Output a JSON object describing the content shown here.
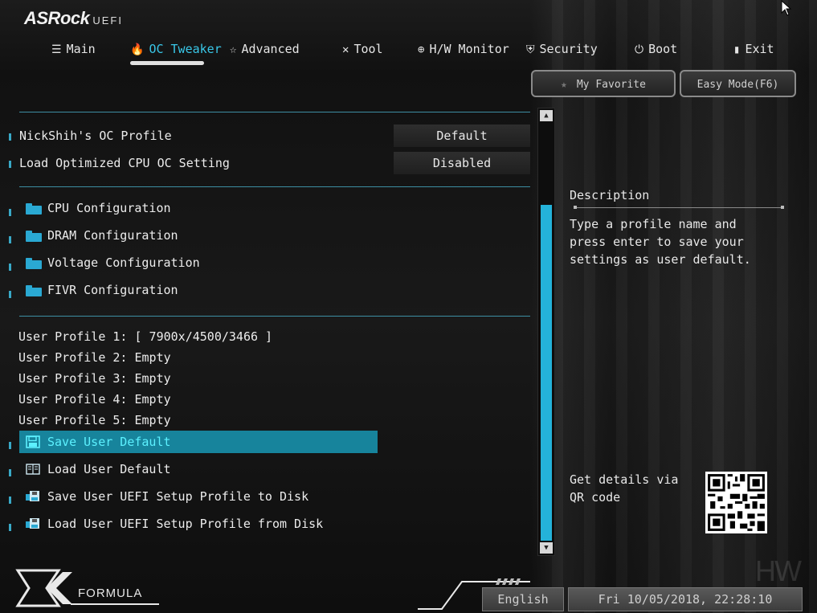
{
  "brand": {
    "name": "ASRock",
    "sub": "UEFI"
  },
  "tabs": [
    {
      "label": "Main",
      "icon": "list-icon"
    },
    {
      "label": "OC Tweaker",
      "icon": "flame-icon",
      "active": true
    },
    {
      "label": "Advanced",
      "icon": "star-icon"
    },
    {
      "label": "Tool",
      "icon": "tools-icon"
    },
    {
      "label": "H/W Monitor",
      "icon": "crosshair-icon"
    },
    {
      "label": "Security",
      "icon": "shield-icon"
    },
    {
      "label": "Boot",
      "icon": "power-icon"
    },
    {
      "label": "Exit",
      "icon": "exit-icon"
    }
  ],
  "top_buttons": {
    "favorite": "My Favorite",
    "easy_mode": "Easy Mode(F6)"
  },
  "settings": [
    {
      "label": "NickShih's OC Profile",
      "value": "Default"
    },
    {
      "label": "Load Optimized CPU OC Setting",
      "value": "Disabled"
    }
  ],
  "folders": [
    {
      "label": "CPU Configuration"
    },
    {
      "label": "DRAM Configuration"
    },
    {
      "label": "Voltage Configuration"
    },
    {
      "label": "FIVR Configuration"
    }
  ],
  "profiles": [
    {
      "label": "User Profile 1: [ 7900x/4500/3466 ]"
    },
    {
      "label": "User Profile 2: Empty"
    },
    {
      "label": "User Profile 3: Empty"
    },
    {
      "label": "User Profile 4: Empty"
    },
    {
      "label": "User Profile 5: Empty"
    }
  ],
  "actions": [
    {
      "label": "Save User Default",
      "icon": "floppy-icon",
      "selected": true
    },
    {
      "label": "Load User Default",
      "icon": "book-icon"
    },
    {
      "label": "Save User UEFI Setup Profile to Disk",
      "icon": "floppy-disk-icon"
    },
    {
      "label": "Load User UEFI Setup Profile from Disk",
      "icon": "floppy-disk-icon"
    }
  ],
  "description": {
    "title": "Description",
    "text": "Type a profile name and press enter to save your settings as user default."
  },
  "qr": {
    "text": "Get details via QR code"
  },
  "footer": {
    "brand": "FORMULA",
    "language": "English",
    "datetime": "Fri 10/05/2018, 22:28:10"
  },
  "colors": {
    "accent": "#39c7e8",
    "selected_row": "#17849c",
    "scroll_thumb": "#24b2d9"
  }
}
